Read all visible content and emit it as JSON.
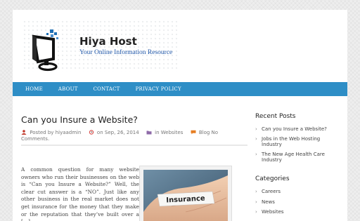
{
  "site": {
    "title": "Hiya Host",
    "tagline": "Your Online Information Resource"
  },
  "nav": {
    "items": [
      "HOME",
      "ABOUT",
      "CONTACT",
      "PRIVACY POLICY"
    ]
  },
  "post": {
    "title": "Can you Insure a Website?",
    "meta": {
      "author_prefix": "Posted by",
      "author": "hiyaadmin",
      "date_prefix": "on",
      "date": "Sep, 26, 2014",
      "category_prefix": "in",
      "category": "Websites",
      "comments": "Blog No Comments."
    },
    "excerpt": "A common question for many website owners who run their businesses on the web is “Can you Insure a Website?” Well, the clear cut answer is a “NO”. Just like any other business in the real market does not get insurance for the money that they make or the reputation that they’ve built over a […]",
    "image_text": "Insurance"
  },
  "sidebar": {
    "recent_heading": "Recent Posts",
    "recent": [
      "Can you Insure a Website?",
      "Jobs in the Web Hosting Industry",
      "The New Age Health Care Industry"
    ],
    "categories_heading": "Categories",
    "categories": [
      "Careers",
      "News",
      "Websites"
    ]
  },
  "colors": {
    "nav": "#2e8ec6",
    "tagline": "#1f56a8",
    "logo_blue": "#1e6fb5"
  },
  "icons": {
    "author": "user-icon",
    "date": "clock-icon",
    "category": "folder-icon",
    "comments": "comment-icon",
    "list_bullet": "chevron-right-icon"
  }
}
